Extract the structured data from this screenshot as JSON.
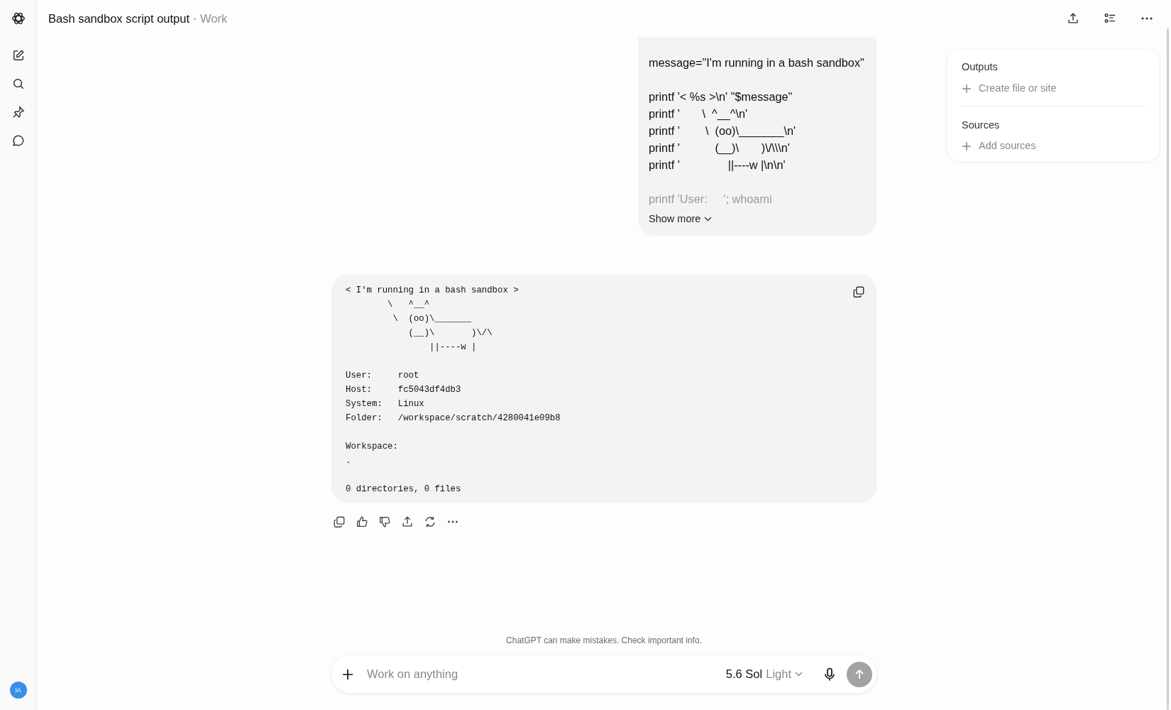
{
  "header": {
    "title": "Bash sandbox script output",
    "workspace": "Work"
  },
  "sidebar": {
    "avatar": "IA"
  },
  "user_message": {
    "blocks": [
      [
        "message=\"I'm running in a bash sandbox\""
      ],
      [
        "printf '< %s >\\n' \"$message\"",
        "printf '       \\  ^__^\\n'",
        "printf '        \\  (oo)\\_______\\n'",
        "printf '           (__)\\       )\\/\\\\\\n'",
        "printf '               ||----w |\\n\\n'"
      ]
    ],
    "faded_line": "printf 'User:     '; whoami",
    "show_more": "Show more"
  },
  "output": {
    "blocks": [
      [
        "< I'm running in a bash sandbox >",
        "        \\   ^__^",
        "         \\  (oo)\\_______",
        "            (__)\\       )\\/\\",
        "                ||----w |"
      ],
      [
        "User:     root",
        "Host:     fc5043df4db3",
        "System:   Linux",
        "Folder:   /workspace/scratch/4280041e09b8"
      ],
      [
        "Workspace:",
        "."
      ],
      [
        "0 directories, 0 files"
      ]
    ]
  },
  "panel": {
    "sections": [
      {
        "title": "Outputs",
        "action": "Create file or site"
      },
      {
        "title": "Sources",
        "action": "Add sources"
      }
    ]
  },
  "disclaimer": "ChatGPT can make mistakes. Check important info.",
  "composer": {
    "placeholder": "Work on anything",
    "model": "5.6 Sol",
    "effort": "Light"
  }
}
